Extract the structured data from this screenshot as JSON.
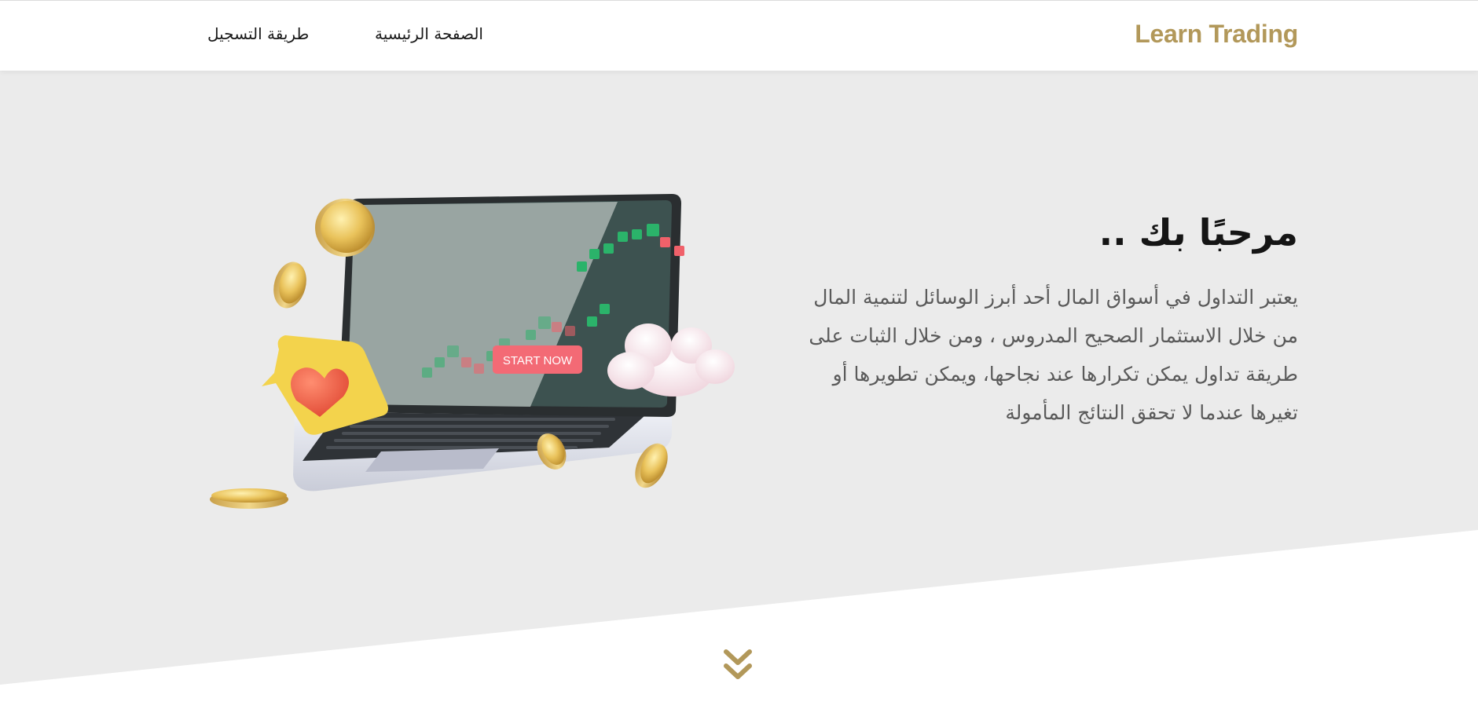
{
  "header": {
    "brand": "Learn Trading",
    "nav": [
      {
        "label": "الصفحة الرئيسية"
      },
      {
        "label": "طريقة التسجيل"
      }
    ]
  },
  "hero": {
    "title": "مرحبًا بك ..",
    "body": "يعتبر التداول في أسواق المال أحد أبرز الوسائل لتنمية المال من خلال الاستثمار الصحيح المدروس ، ومن خلال الثبات على طريقة تداول يمكن تكرارها عند نجاحها، ويمكن تطويرها أو تغيرها عندما لا تحقق النتائج المأمولة",
    "illustration": {
      "cta_label": "START NOW",
      "icons": [
        "laptop-icon",
        "coin-icon",
        "heart-bubble-icon",
        "cloud-icon",
        "candlestick-chart-icon"
      ]
    }
  },
  "scroll": {
    "icon": "double-chevron-down-icon"
  },
  "colors": {
    "accent": "#b2985a",
    "hero_background": "#ebebeb",
    "text_dark": "#151515",
    "text_body": "#5a5a5a",
    "screen_light": "#99a5a2",
    "screen_dark": "#3d5250",
    "candle_up": "#2bb36a",
    "candle_down": "#f0616a",
    "cta": "#f36a75"
  }
}
